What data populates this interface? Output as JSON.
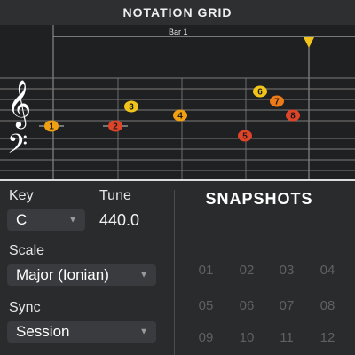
{
  "header": {
    "title": "NOTATION GRID"
  },
  "grid": {
    "bar_label": "Bar 1",
    "notes": [
      {
        "label": "1",
        "color": "#f0a010"
      },
      {
        "label": "2",
        "color": "#e04428"
      },
      {
        "label": "3",
        "color": "#f0c41a"
      },
      {
        "label": "4",
        "color": "#f0a010"
      },
      {
        "label": "5",
        "color": "#e04428"
      },
      {
        "label": "6",
        "color": "#f0c41a"
      },
      {
        "label": "7",
        "color": "#ec7a18"
      },
      {
        "label": "8",
        "color": "#e04428"
      }
    ],
    "playhead_color": "#f0c41a",
    "icons": {
      "treble": "treble-clef-icon",
      "bass": "bass-clef-icon",
      "playhead": "playhead-triangle-icon"
    }
  },
  "settings": {
    "key_label": "Key",
    "key_value": "C",
    "tune_label": "Tune",
    "tune_value": "440.0",
    "scale_label": "Scale",
    "scale_value": "Major (Ionian)",
    "sync_label": "Sync",
    "sync_value": "Session"
  },
  "snapshots": {
    "title": "SNAPSHOTS",
    "slots": [
      "01",
      "02",
      "03",
      "04",
      "05",
      "06",
      "07",
      "08",
      "09",
      "10",
      "11",
      "12"
    ]
  }
}
